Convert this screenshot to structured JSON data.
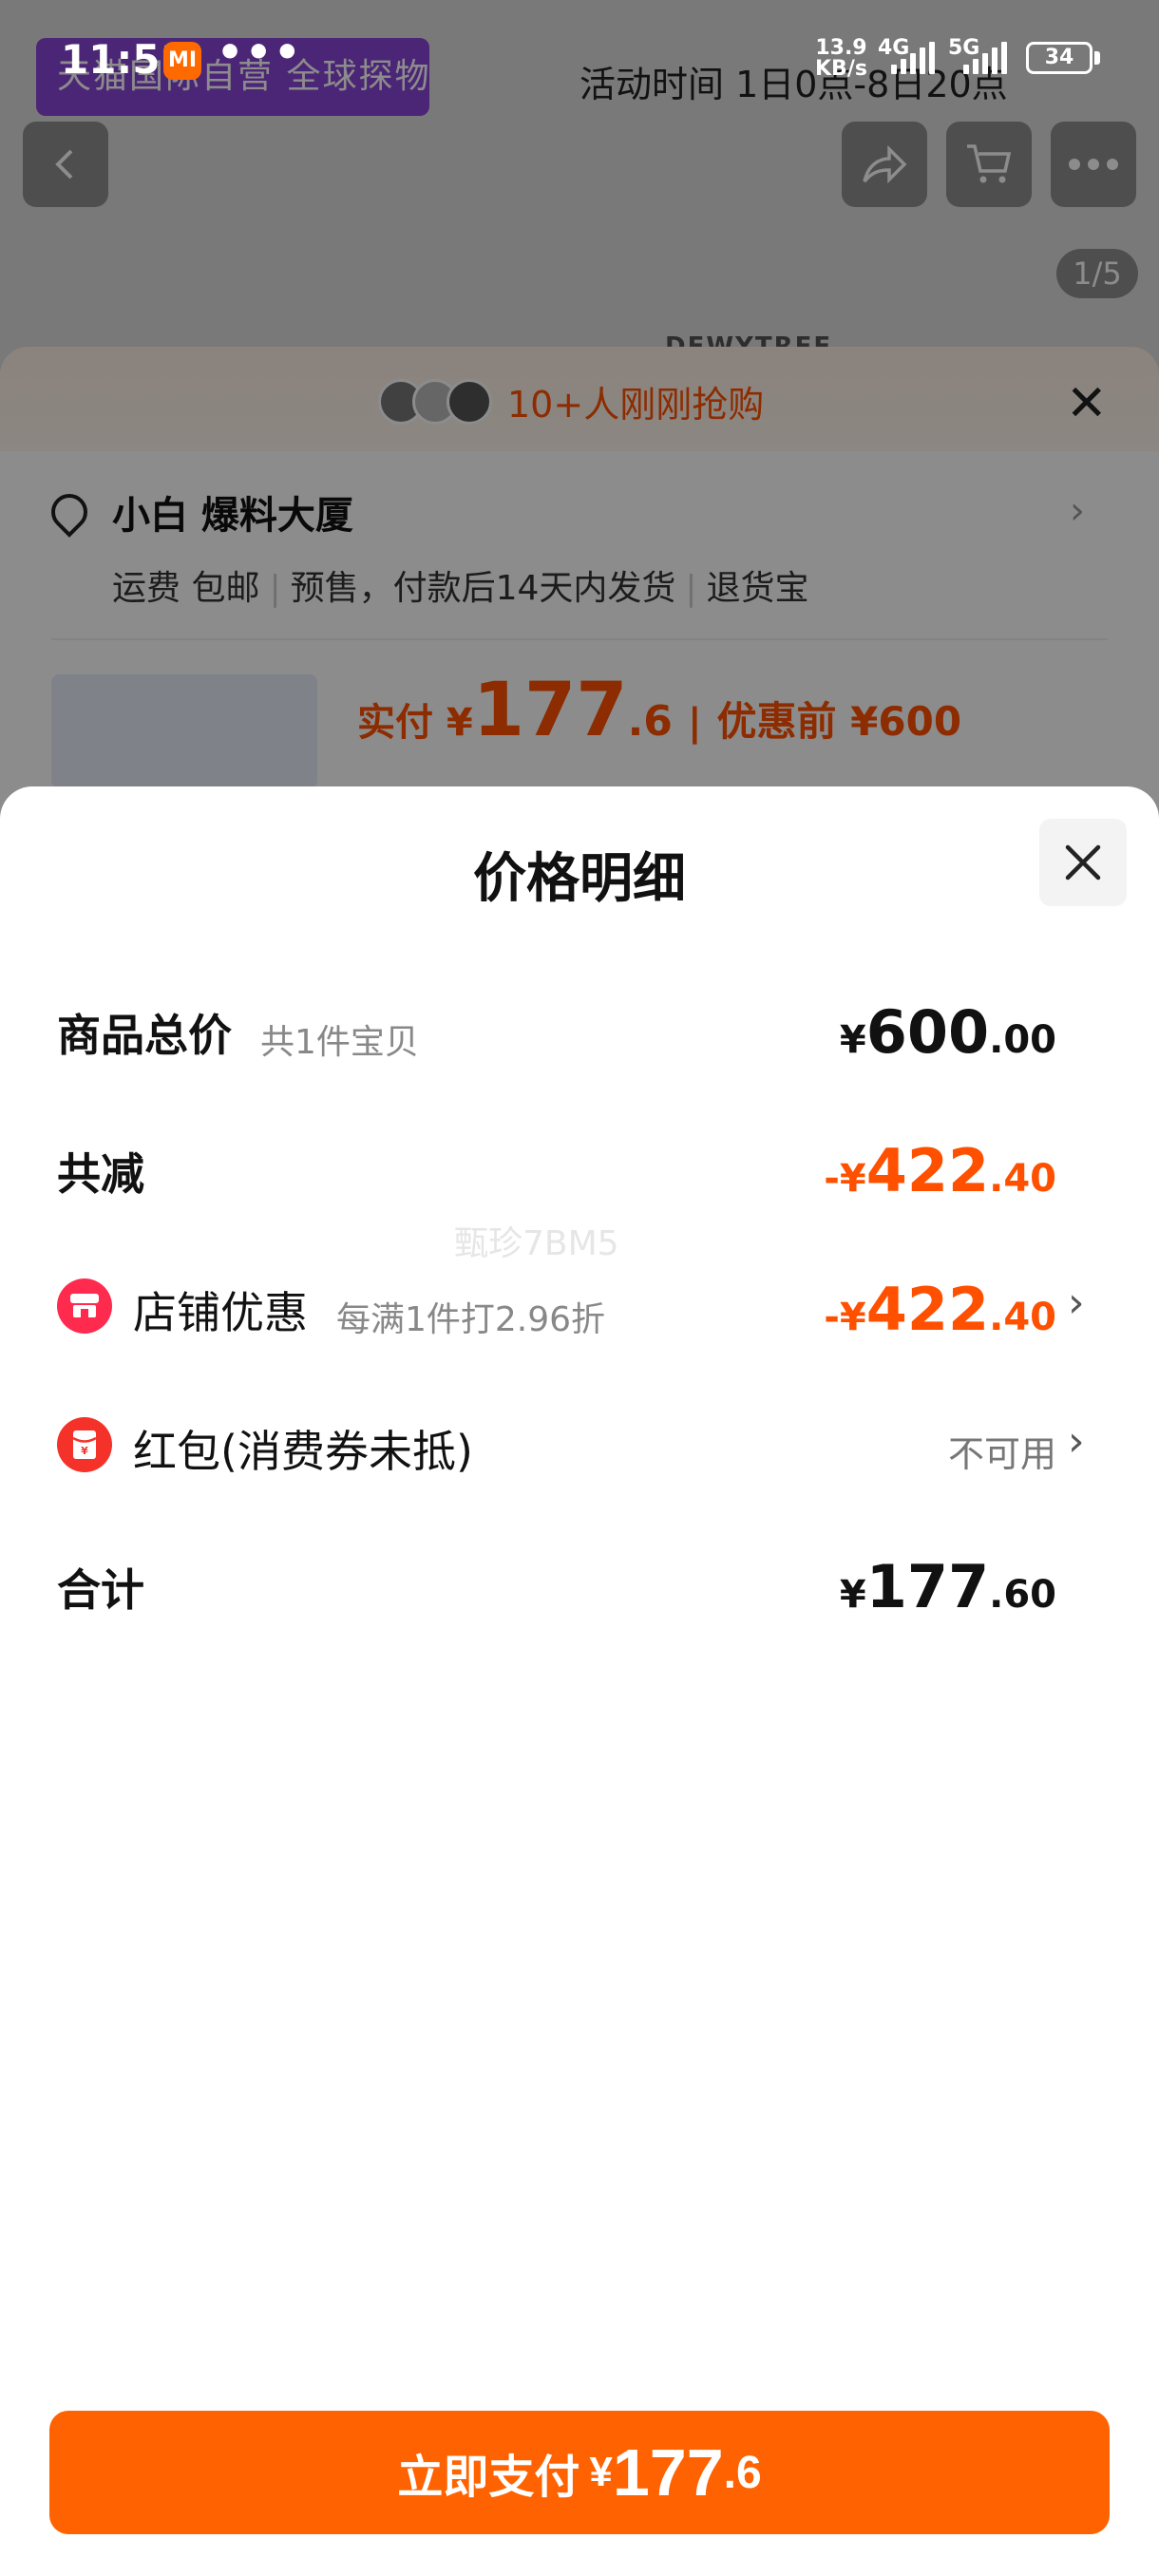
{
  "status_bar": {
    "time": "11:51",
    "mi_badge": "MI",
    "more_dots": "•••",
    "net_speed": "13.9",
    "net_unit": "KB/s",
    "sig1": "4G",
    "sig2": "5G",
    "battery": "34"
  },
  "background_page": {
    "store_banner": "天猫国际自营 全球探物",
    "activity_time": "活动时间  1日0点-8日20点",
    "image_counter": "1/5",
    "brand_text": "DEWYTREE",
    "grab_text": "10+人刚刚抢购",
    "address": "小白 爆料大厦",
    "shipping": [
      "运费 包邮",
      "预售，付款后14天内发货",
      "退货宝"
    ],
    "pay_label": "实付 ¥",
    "pay_int": "177",
    "pay_dec": ".6",
    "orig_price": "优惠前 ¥600"
  },
  "modal": {
    "title": "价格明细",
    "watermark": "甄珍7BM5",
    "rows": {
      "total": {
        "label": "商品总价",
        "sub": "共1件宝贝",
        "sym": "¥",
        "int": "600",
        "dec": ".00"
      },
      "reduce": {
        "label": "共减",
        "sym": "-¥",
        "int": "422",
        "dec": ".40"
      },
      "store": {
        "label": "店铺优惠",
        "sub": "每满1件打2.96折",
        "sym": "-¥",
        "int": "422",
        "dec": ".40"
      },
      "redpacket": {
        "label": "红包(消费券未抵)",
        "value": "不可用"
      },
      "sum": {
        "label": "合计",
        "sym": "¥",
        "int": "177",
        "dec": ".60"
      }
    },
    "pay_button": {
      "label": "立即支付",
      "sym": "¥",
      "int": "177",
      "dec": ".6"
    }
  },
  "colors": {
    "accent": "#ff5000",
    "button": "#ff6200",
    "store_icon": "#ff2b4e"
  }
}
